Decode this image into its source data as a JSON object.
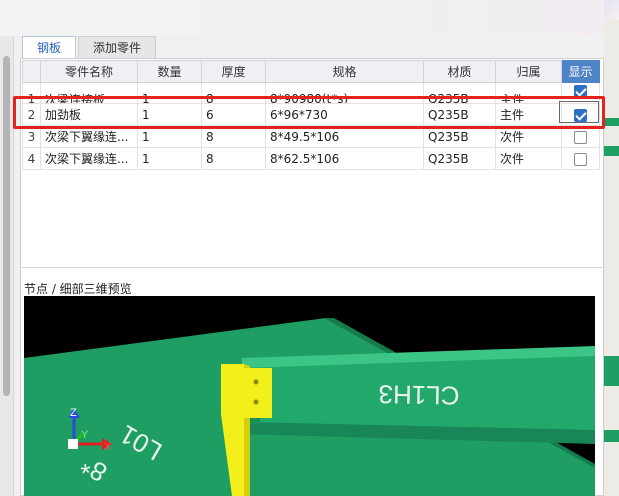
{
  "tabs": [
    {
      "label": "钢板",
      "active": true
    },
    {
      "label": "添加零件",
      "active": false
    }
  ],
  "table": {
    "headers": [
      "",
      "零件名称",
      "数量",
      "厚度",
      "规格",
      "材质",
      "归属",
      "显示"
    ],
    "rows": [
      {
        "idx": "1",
        "name": "次梁连接板",
        "qty": "1",
        "thick": "8",
        "spec": "8*90980(t*s)",
        "mat": "Q235B",
        "owner": "主件",
        "show": true
      },
      {
        "idx": "2",
        "name": "加劲板",
        "qty": "1",
        "thick": "6",
        "spec": "6*96*730",
        "mat": "Q235B",
        "owner": "主件",
        "show": true
      },
      {
        "idx": "3",
        "name": "次梁下翼缘连...",
        "qty": "1",
        "thick": "8",
        "spec": "8*49.5*106",
        "mat": "Q235B",
        "owner": "次件",
        "show": false
      },
      {
        "idx": "4",
        "name": "次梁下翼缘连...",
        "qty": "1",
        "thick": "8",
        "spec": "8*62.5*106",
        "mat": "Q235B",
        "owner": "次件",
        "show": false
      }
    ]
  },
  "preview": {
    "label": "节点 / 细部三维预览",
    "beam_text": "CL1H3",
    "floor_text_1": "L01",
    "floor_text_2": "8*",
    "axis_z": "Z",
    "axis_y": "Y",
    "axis_x": "X"
  },
  "colors": {
    "accent": "#4f84c6",
    "highlight": "#e3231c",
    "steel_green": "#1f9e64",
    "plate_yellow": "#f2ef1a"
  }
}
